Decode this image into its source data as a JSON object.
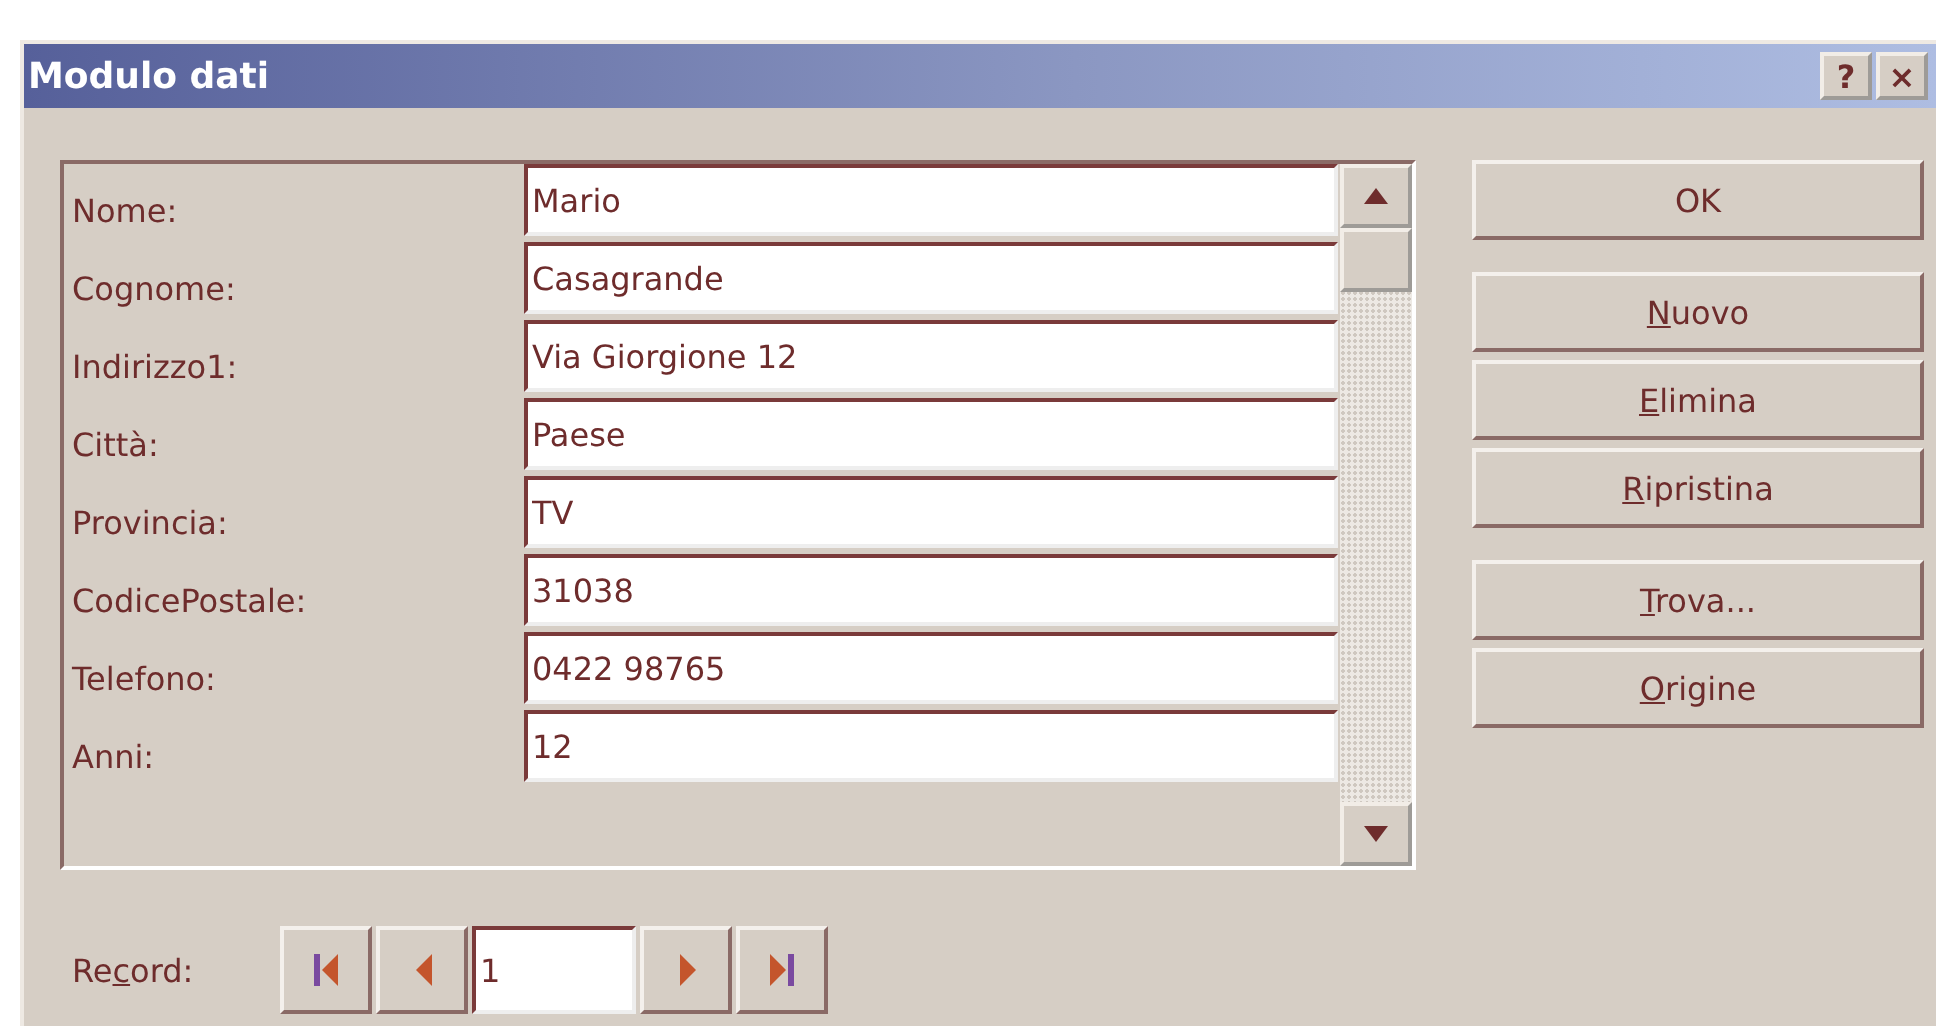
{
  "window": {
    "title": "Modulo dati",
    "title_buttons": [
      "?",
      "×"
    ]
  },
  "fields": [
    {
      "label": "Nome:",
      "value": "Mario"
    },
    {
      "label": "Cognome:",
      "value": "Casagrande"
    },
    {
      "label": "Indirizzo1:",
      "value": "Via Giorgione 12"
    },
    {
      "label": "Città:",
      "value": "Paese"
    },
    {
      "label": "Provincia:",
      "value": "TV"
    },
    {
      "label": "CodicePostale:",
      "value": "31038"
    },
    {
      "label": "Telefono:",
      "value": "0422 98765"
    },
    {
      "label": "Anni:",
      "value": "12"
    }
  ],
  "buttons": [
    {
      "label": "OK"
    },
    {
      "access_key": "N",
      "label_rest": "uovo"
    },
    {
      "access_key": "E",
      "label_rest": "limina"
    },
    {
      "access_key": "R",
      "label_rest": "ipristina"
    },
    {
      "access_key": "T",
      "label_rest": "rova..."
    },
    {
      "access_key": "O",
      "label_rest": "rigine"
    }
  ],
  "navigator": {
    "label_start": "Re",
    "access_key": "c",
    "label_end": "ord:",
    "value": "1"
  }
}
